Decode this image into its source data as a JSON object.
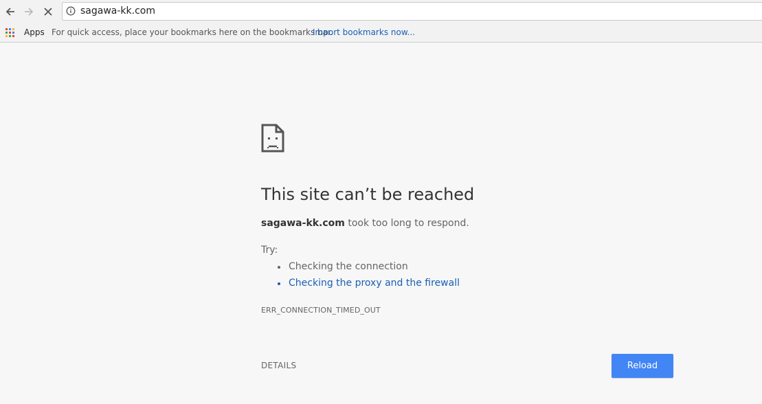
{
  "browser": {
    "url": "sagawa-kk.com",
    "bookmarks_bar": {
      "apps_label": "Apps",
      "hint_text": "For quick access, place your bookmarks here on the bookmarks bar.",
      "import_link": "Import bookmarks now..."
    },
    "icons": {
      "back": "back-arrow-icon",
      "forward": "forward-arrow-icon",
      "stop": "stop-icon",
      "info": "info-icon",
      "apps": "apps-grid-icon"
    }
  },
  "error_page": {
    "icon": "sad-page-icon",
    "title": "This site can’t be reached",
    "host": "sagawa-kk.com",
    "description_suffix": " took too long to respond.",
    "try_label": "Try:",
    "suggestions": [
      {
        "text": "Checking the connection",
        "is_link": false
      },
      {
        "text": "Checking the proxy and the firewall",
        "is_link": true
      }
    ],
    "error_code": "ERR_CONNECTION_TIMED_OUT",
    "details_label": "DETAILS",
    "reload_label": "Reload"
  },
  "colors": {
    "background": "#f7f7f7",
    "link": "#1a5fb4",
    "reload_button": "#4285f4"
  }
}
